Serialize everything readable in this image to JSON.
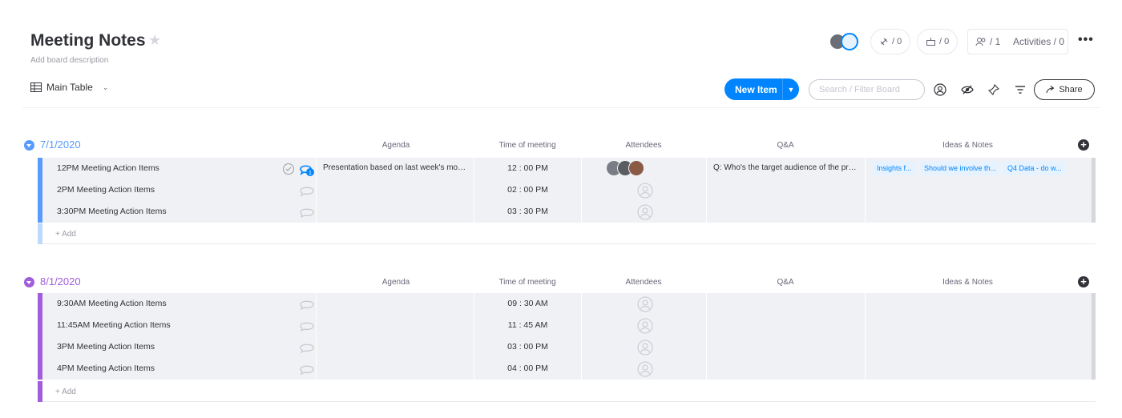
{
  "board": {
    "title": "Meeting Notes",
    "description": "Add board description",
    "view_label": "Main Table"
  },
  "header": {
    "integrations_count": "/ 0",
    "automations_count": "/ 0",
    "members_count": "/ 1",
    "activities_label": "Activities / 0",
    "more_label": "•••"
  },
  "toolbar": {
    "new_item_label": "New Item",
    "search_placeholder": "Search / Filter Board",
    "share_label": "Share"
  },
  "columns": [
    "Agenda",
    "Time of meeting",
    "Attendees",
    "Q&A",
    "Ideas & Notes"
  ],
  "add_label": "+ Add",
  "colors": {
    "accent": "#0085ff",
    "group1": "#579bfc",
    "group2": "#a25ddc",
    "group1_add_bar": "#bdd9fd",
    "group2_add_bar": "#a25ddc"
  },
  "groups": [
    {
      "title": "7/1/2020",
      "color": "#579bfc",
      "rows": [
        {
          "name": "12PM Meeting Action Items",
          "agenda": "Presentation based on last week's mont...",
          "time": "12 : 00 PM",
          "qa": "Q: Who's the target audience of the pres...",
          "tags": [
            "Insights f...",
            "Should we involve th...",
            "Q4 Data - do w..."
          ]
        },
        {
          "name": "2PM Meeting Action Items",
          "agenda": "",
          "time": "02 : 00 PM",
          "qa": "",
          "tags": []
        },
        {
          "name": "3:30PM Meeting Action Items",
          "agenda": "",
          "time": "03 : 30 PM",
          "qa": "",
          "tags": []
        }
      ]
    },
    {
      "title": "8/1/2020",
      "color": "#a25ddc",
      "rows": [
        {
          "name": "9:30AM Meeting Action Items",
          "agenda": "",
          "time": "09 : 30 AM",
          "qa": "",
          "tags": []
        },
        {
          "name": "11:45AM Meeting Action Items",
          "agenda": "",
          "time": "11 : 45 AM",
          "qa": "",
          "tags": []
        },
        {
          "name": "3PM Meeting Action Items",
          "agenda": "",
          "time": "03 : 00 PM",
          "qa": "",
          "tags": []
        },
        {
          "name": "4PM Meeting Action Items",
          "agenda": "",
          "time": "04 : 00 PM",
          "qa": "",
          "tags": []
        }
      ]
    }
  ]
}
